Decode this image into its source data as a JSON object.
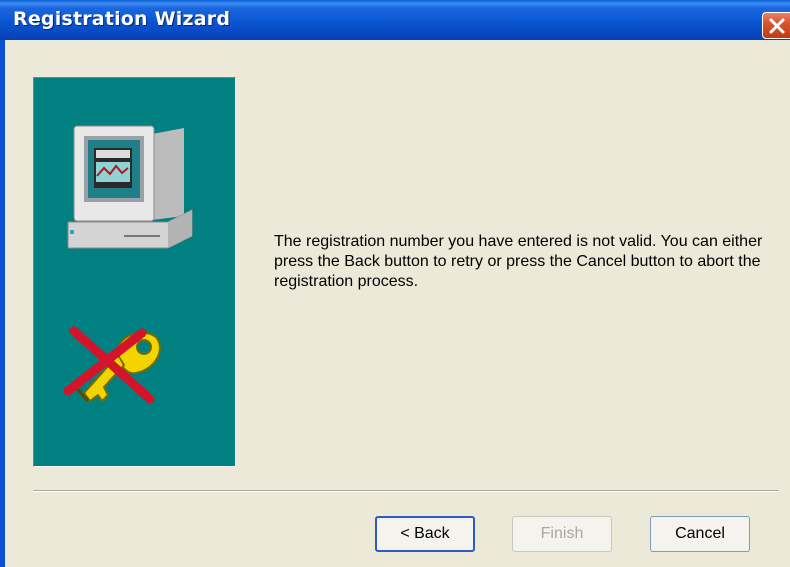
{
  "window": {
    "title": "Registration Wizard",
    "close_icon": "close-icon"
  },
  "art": {
    "computer_icon": "computer-icon",
    "key_icon": "key-icon",
    "cross_icon": "red-x-icon",
    "panel_color": "#008080"
  },
  "message": "The registration number you have entered is not valid. You can either press the Back button to retry or press the Cancel button to abort the registration process.",
  "buttons": {
    "back_label": "< Back",
    "finish_label": "Finish",
    "cancel_label": "Cancel"
  },
  "colors": {
    "titlebar": "#0a55d2",
    "close_button": "#d9542c",
    "dialog_bg": "#ece9d8"
  }
}
